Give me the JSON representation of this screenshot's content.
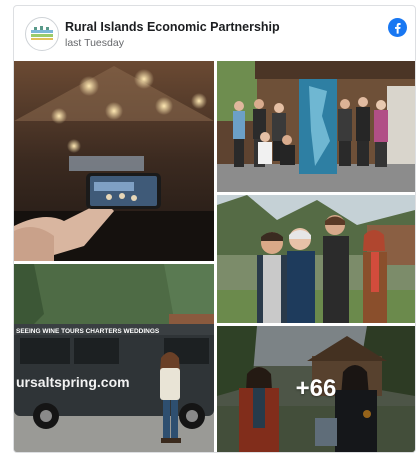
{
  "post": {
    "page_name": "Rural Islands Economic Partnership",
    "timestamp": "last Tuesday"
  },
  "brand": {
    "facebook_blue": "#1877f2",
    "logo_icon": "rural-islands-logo-icon",
    "platform_icon": "facebook-icon"
  },
  "gallery": {
    "more_count": "+66",
    "photos": [
      {
        "name": "photo-phone-recording-event"
      },
      {
        "name": "photo-group-with-map-banner"
      },
      {
        "name": "photo-woman-by-tour-van",
        "van_text": "ursaltspring.com",
        "van_banner": "SEEING   WINE TOURS   CHARTERS   WEDDINGS"
      },
      {
        "name": "photo-four-people-smiling"
      },
      {
        "name": "photo-women-talking-outdoors"
      }
    ]
  }
}
